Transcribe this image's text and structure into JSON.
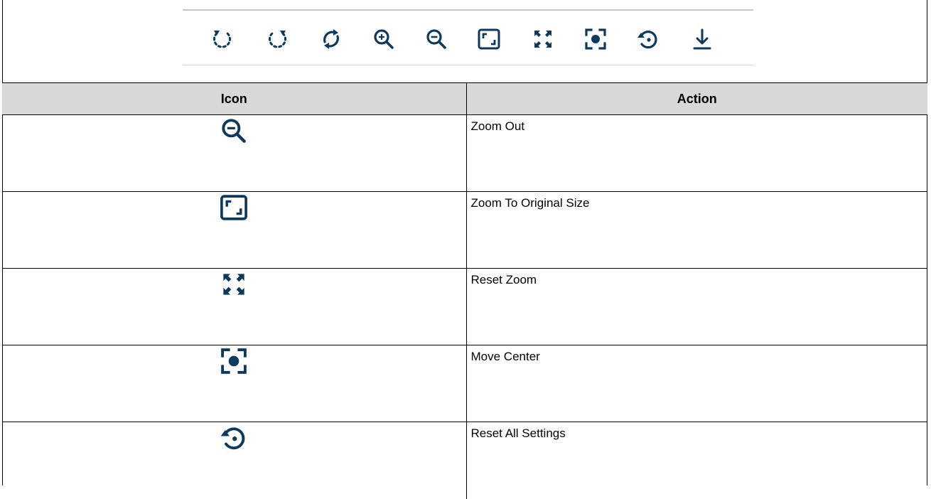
{
  "colors": {
    "icon": "#0d3a5c",
    "header_bg": "#d8d8d8",
    "border": "#000000"
  },
  "toolbar": {
    "icons": [
      "rotate-left-icon",
      "rotate-right-icon",
      "flip-icon",
      "zoom-in-icon",
      "zoom-out-icon",
      "original-size-icon",
      "reset-zoom-icon",
      "move-center-icon",
      "reset-all-icon",
      "download-icon"
    ]
  },
  "table": {
    "headers": {
      "icon": "Icon",
      "action": "Action"
    },
    "rows": [
      {
        "icon": "zoom-out-icon",
        "action": "Zoom Out"
      },
      {
        "icon": "original-size-icon",
        "action": "Zoom To Original Size"
      },
      {
        "icon": "reset-zoom-icon",
        "action": "Reset Zoom"
      },
      {
        "icon": "move-center-icon",
        "action": "Move Center"
      },
      {
        "icon": "reset-all-icon",
        "action": "Reset All Settings"
      }
    ]
  }
}
